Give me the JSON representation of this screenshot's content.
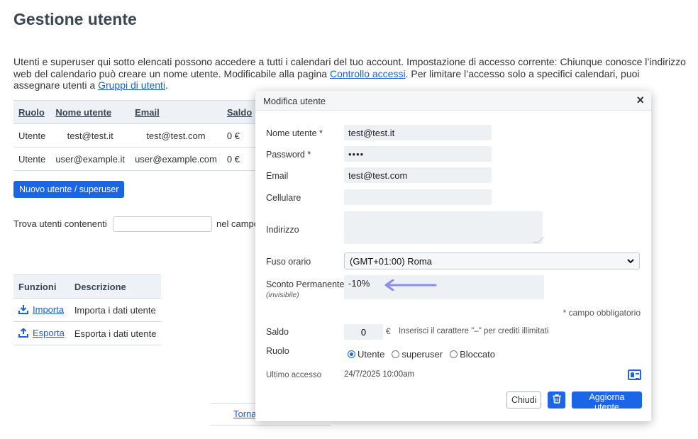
{
  "page": {
    "title": "Gestione utente",
    "intro_part1": "Utenti e superuser qui sotto elencati possono accedere a tutti i calendari del tuo account. Impostazione di accesso corrente: Chiunque conosce l’indirizzo web del calendario può creare un nome utente. Modificabile alla pagina ",
    "intro_link1": "Controllo accessi",
    "intro_part2": ". Per limitare l’accesso solo a specifici calendari, puoi assegnare utenti a ",
    "intro_link2": "Gruppi di utenti",
    "intro_part3": "."
  },
  "users_table": {
    "headers": [
      "Ruolo",
      "Nome utente",
      "Email",
      "Saldo"
    ],
    "rows": [
      {
        "role": "Utente",
        "username": "test@test.it",
        "email": "test@test.com",
        "balance": "0 €"
      },
      {
        "role": "Utente",
        "username": "user@example.it",
        "email": "user@example.com",
        "balance": "0 €"
      }
    ]
  },
  "new_user_button": "Nuovo utente / superuser",
  "search": {
    "label": "Trova utenti contenenti",
    "value": "",
    "field_label": "nel campo"
  },
  "functions_table": {
    "headers": [
      "Funzioni",
      "Descrizione"
    ],
    "rows": [
      {
        "name": "Importa",
        "description": "Importa i dati utente",
        "icon": "download-icon"
      },
      {
        "name": "Esporta",
        "description": "Esporta i dati utente",
        "icon": "upload-icon"
      }
    ]
  },
  "footer_link": "Torna",
  "modal": {
    "title": "Modifica utente",
    "close_symbol": "×",
    "fields": {
      "username_label": "Nome utente *",
      "username_value": "test@test.it",
      "password_label": "Password *",
      "password_value": "••••",
      "email_label": "Email",
      "email_value": "test@test.com",
      "mobile_label": "Cellulare",
      "mobile_value": "",
      "address_label": "Indirizzo",
      "address_value": "",
      "timezone_label": "Fuso orario",
      "timezone_value": "(GMT+01:00) Roma",
      "discount_label": "Sconto Permanente",
      "discount_sub": "(invisibile)",
      "discount_value": "-10%",
      "required_note": "* campo obbligatorio",
      "balance_label": "Saldo",
      "balance_value": "0",
      "balance_currency": "€",
      "balance_hint": "Inserisci il carattere \"–\" per crediti illimitati",
      "role_label": "Ruolo",
      "roles": [
        "Utente",
        "superuser",
        "Bloccato"
      ],
      "role_selected": "Utente",
      "last_access_label": "Ultimo accesso",
      "last_access_value": "24/7/2025 10:00am"
    },
    "buttons": {
      "close": "Chiudi",
      "delete_icon": "trash-icon",
      "update": "Aggiorna utente"
    },
    "accent_color": "#1a66e6",
    "arrow_color": "#8c8cf0"
  }
}
